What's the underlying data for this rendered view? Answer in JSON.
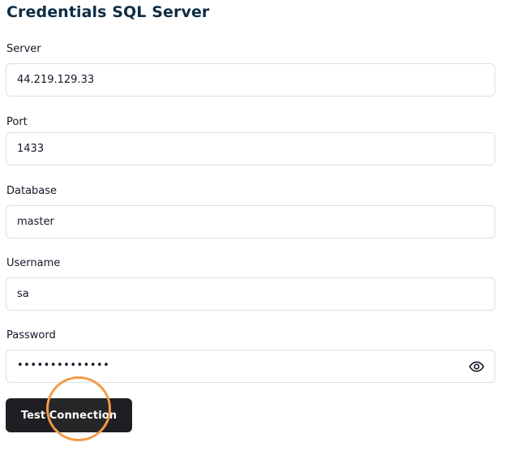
{
  "title": "Credentials SQL Server",
  "fields": {
    "server": {
      "label": "Server",
      "value": "44.219.129.33"
    },
    "port": {
      "label": "Port",
      "value": "1433"
    },
    "database": {
      "label": "Database",
      "value": "master"
    },
    "username": {
      "label": "Username",
      "value": "sa"
    },
    "password": {
      "label": "Password",
      "value": "••••••••••••••"
    }
  },
  "icons": {
    "password_toggle": "eye-icon"
  },
  "button": {
    "label": "Test Connection"
  },
  "colors": {
    "title": "#0f2d44",
    "button_bg": "#1f1f23",
    "highlight_ring": "#f39b47",
    "input_border": "#dcdfe4"
  }
}
